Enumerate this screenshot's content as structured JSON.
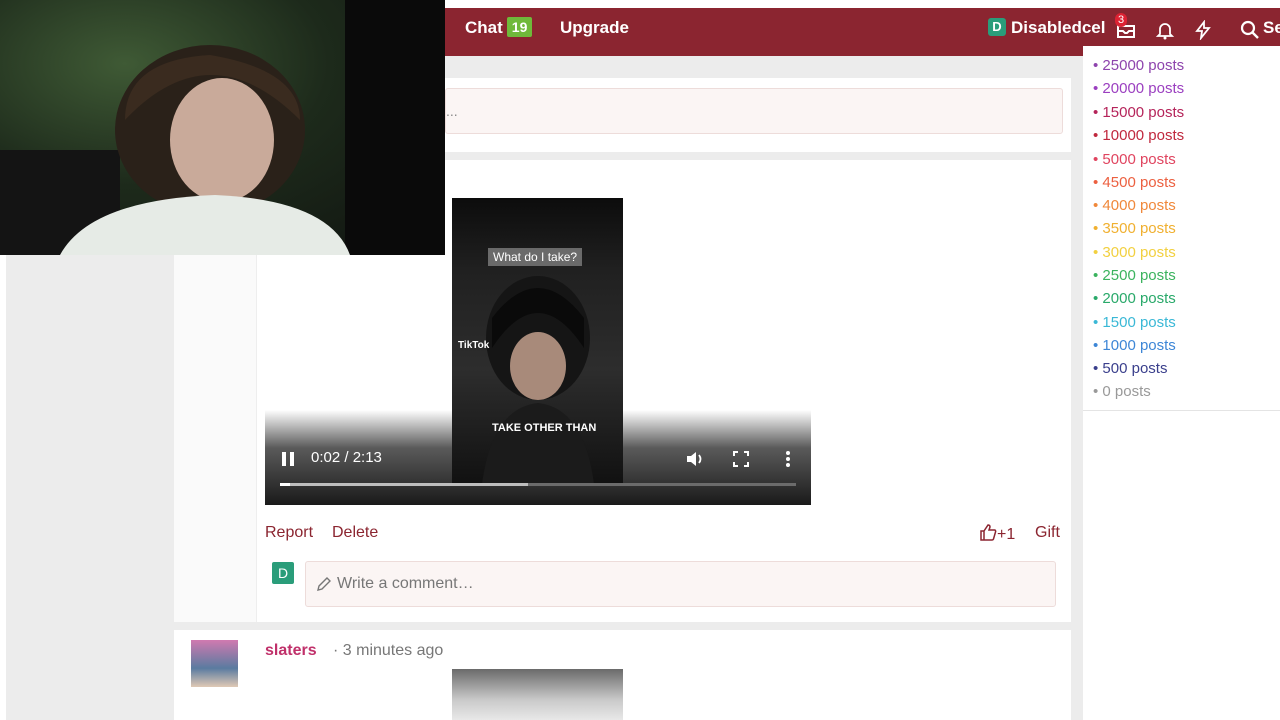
{
  "nav": {
    "chat_label": "Chat",
    "chat_count": "19",
    "upgrade_label": "Upgrade",
    "avatar_letter": "D",
    "username": "Disabledcel",
    "messages_count": "3",
    "search_label": "Se"
  },
  "reply_placeholder": "...",
  "sidebar": {
    "ranks": [
      {
        "label": "25000 posts",
        "color": "#8e44ad"
      },
      {
        "label": "20000 posts",
        "color": "#9b3fc0"
      },
      {
        "label": "15000 posts",
        "color": "#b5245a"
      },
      {
        "label": "10000 posts",
        "color": "#c0283e"
      },
      {
        "label": "5000 posts",
        "color": "#e0445f"
      },
      {
        "label": "4500 posts",
        "color": "#ec6040"
      },
      {
        "label": "4000 posts",
        "color": "#f0883a"
      },
      {
        "label": "3500 posts",
        "color": "#f0b030"
      },
      {
        "label": "3000 posts",
        "color": "#f2d040"
      },
      {
        "label": "2500 posts",
        "color": "#3bb35e"
      },
      {
        "label": "2000 posts",
        "color": "#29a96a"
      },
      {
        "label": "1500 posts",
        "color": "#3ab8d6"
      },
      {
        "label": "1000 posts",
        "color": "#3d86d6"
      },
      {
        "label": "500 posts",
        "color": "#3a3f8c"
      },
      {
        "label": "0 posts",
        "color": "#999999"
      }
    ]
  },
  "video": {
    "caption_top": "What do I take?",
    "tiktok_label": "TikTok",
    "caption_bottom": "TAKE OTHER THAN",
    "time": "0:02 / 2:13",
    "played_fraction": 0.02,
    "buffered_fraction": 0.48
  },
  "post_actions": {
    "report": "Report",
    "delete": "Delete",
    "like": "+1",
    "gift": "Gift"
  },
  "comment": {
    "avatar_letter": "D",
    "placeholder": "Write a comment…"
  },
  "next_post": {
    "username": "slaters",
    "time": "· 3 minutes ago"
  },
  "colors": {
    "brand": "#8b2530",
    "chat_badge": "#6fb93a",
    "avatar": "#2a9d7a"
  }
}
